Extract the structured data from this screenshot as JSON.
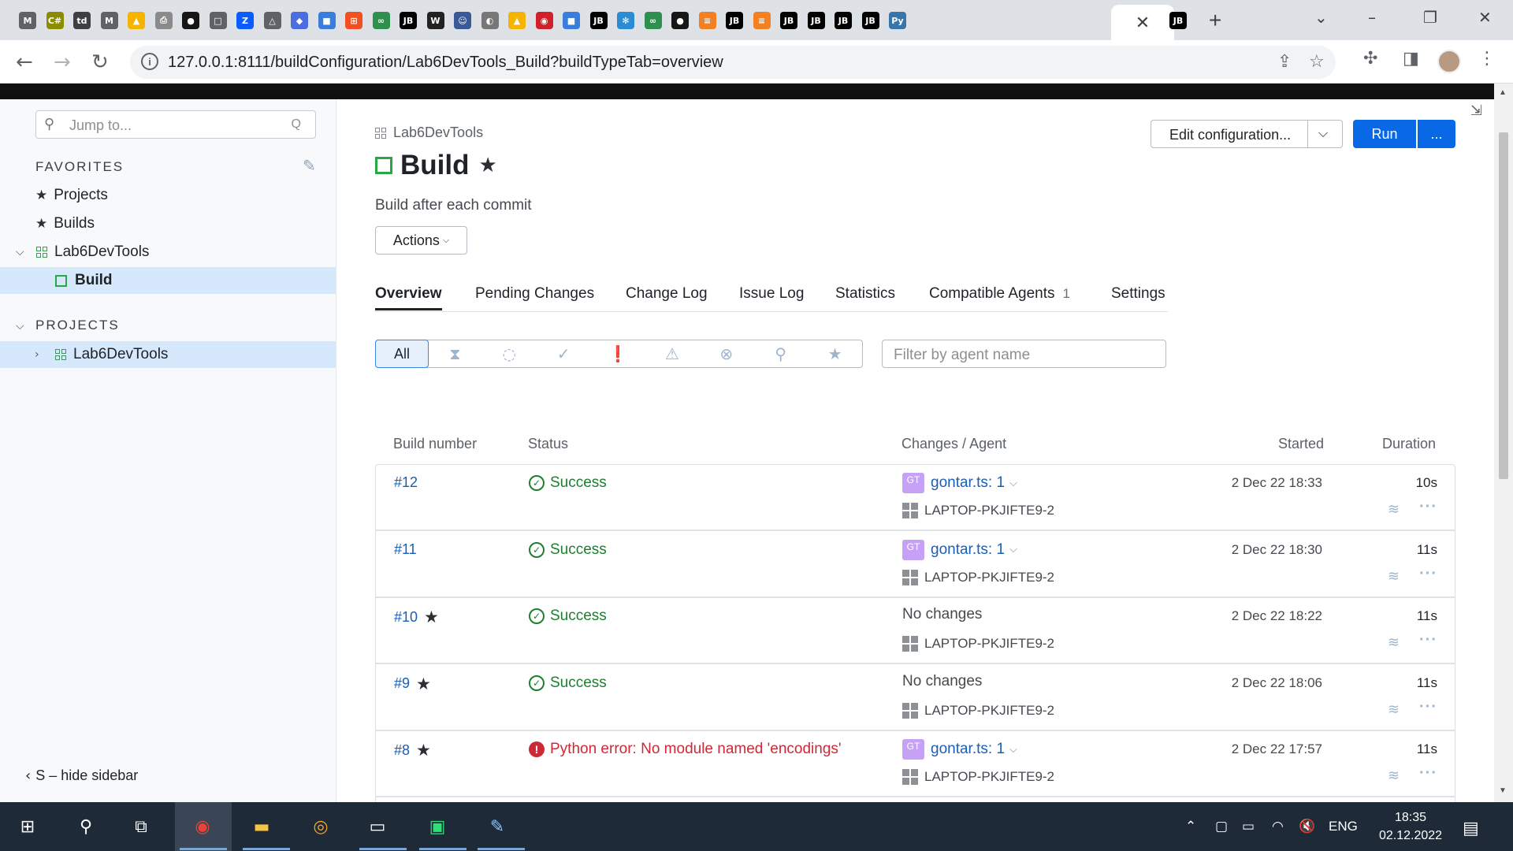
{
  "browser": {
    "tabs": [
      {
        "icon": "gmail-icon",
        "glyph": "M",
        "color": "#5f6368"
      },
      {
        "icon": "cpp-icon",
        "glyph": "C#",
        "color": "#8c8c00"
      },
      {
        "icon": "td-icon",
        "glyph": "td",
        "color": "#3c4043"
      },
      {
        "icon": "gmail-icon",
        "glyph": "M",
        "color": "#5f6368"
      },
      {
        "icon": "google-drive-icon",
        "glyph": "▲",
        "color": "#f4b400"
      },
      {
        "icon": "printer-icon",
        "glyph": "⎙",
        "color": "#8a8a8a"
      },
      {
        "icon": "github-icon",
        "glyph": "●",
        "color": "#161616"
      },
      {
        "icon": "blank-page-icon",
        "glyph": "□",
        "color": "#5f6368"
      },
      {
        "icon": "zoom-icon",
        "glyph": "Z",
        "color": "#0b5cff"
      },
      {
        "icon": "triangle-icon",
        "glyph": "△",
        "color": "#5f6368"
      },
      {
        "icon": "cube-icon",
        "glyph": "◆",
        "color": "#4a6ee0"
      },
      {
        "icon": "box-icon",
        "glyph": "■",
        "color": "#3b7ddd"
      },
      {
        "icon": "microsoft-icon",
        "glyph": "⊞",
        "color": "#f25022"
      },
      {
        "icon": "gitlab-icon",
        "glyph": "∞",
        "color": "#2f8f4f"
      },
      {
        "icon": "jetbrains-icon",
        "glyph": "JB",
        "color": "#000000"
      },
      {
        "icon": "wikipedia-icon",
        "glyph": "W",
        "color": "#222222"
      },
      {
        "icon": "robot-icon",
        "glyph": "☺",
        "color": "#3b5998"
      },
      {
        "icon": "compass-icon",
        "glyph": "◐",
        "color": "#777777"
      },
      {
        "icon": "google-drive-icon",
        "glyph": "▲",
        "color": "#f4b400"
      },
      {
        "icon": "dsp-icon",
        "glyph": "◉",
        "color": "#d0202a"
      },
      {
        "icon": "box-icon",
        "glyph": "■",
        "color": "#3b7ddd"
      },
      {
        "icon": "jetbrains-icon",
        "glyph": "JB",
        "color": "#000000"
      },
      {
        "icon": "gear-icon",
        "glyph": "✻",
        "color": "#2a8cd2"
      },
      {
        "icon": "gitlab-icon",
        "glyph": "∞",
        "color": "#2f8f4f"
      },
      {
        "icon": "github-icon",
        "glyph": "●",
        "color": "#161616"
      },
      {
        "icon": "stackoverflow-icon",
        "glyph": "≡",
        "color": "#f48024"
      },
      {
        "icon": "jetbrains-icon",
        "glyph": "JB",
        "color": "#000000"
      },
      {
        "icon": "stackoverflow-icon",
        "glyph": "≡",
        "color": "#f48024"
      },
      {
        "icon": "jetbrains-icon",
        "glyph": "JB",
        "color": "#000000"
      },
      {
        "icon": "jetbrains-icon",
        "glyph": "JB",
        "color": "#000000"
      },
      {
        "icon": "jetbrains-icon",
        "glyph": "JB",
        "color": "#000000"
      },
      {
        "icon": "jetbrains-icon",
        "glyph": "JB",
        "color": "#000000"
      },
      {
        "icon": "python-icon",
        "glyph": "Py",
        "color": "#3776ab"
      }
    ],
    "active_tab": {
      "close_glyph": "✕"
    },
    "after_tabs": [
      {
        "icon": "jetbrains-icon",
        "glyph": "JB",
        "color": "#000000"
      }
    ],
    "new_tab": "+",
    "url": "127.0.0.1:8111/buildConfiguration/Lab6DevTools_Build?buildTypeTab=overview"
  },
  "sidebar": {
    "search_placeholder": "Jump to...",
    "favorites_head": "FAVORITES",
    "fav_items": [
      "Projects",
      "Builds"
    ],
    "fav_project": "Lab6DevTools",
    "fav_build": "Build",
    "projects_head": "PROJECTS",
    "project": "Lab6DevTools",
    "hide_label": "S – hide sidebar"
  },
  "page": {
    "breadcrumb": "Lab6DevTools",
    "title": "Build",
    "description": "Build after each commit",
    "actions_label": "Actions",
    "edit_label": "Edit configuration...",
    "run_label": "Run",
    "run_more": "...",
    "tabs": [
      "Overview",
      "Pending Changes",
      "Change Log",
      "Issue Log",
      "Statistics",
      "Compatible Agents",
      "Settings"
    ],
    "agents_count": "1",
    "filter_all": "All",
    "agent_filter_placeholder": "Filter by agent name"
  },
  "table": {
    "headers": [
      "Build number",
      "Status",
      "Changes / Agent",
      "Started",
      "Duration"
    ],
    "rows": [
      {
        "number": "#12",
        "starred": false,
        "status": "Success",
        "ok": true,
        "committer": "gontar.ts: 1",
        "agent": "LAPTOP-PKJIFTE9-2",
        "started": "2 Dec 22 18:33",
        "duration": "10s"
      },
      {
        "number": "#11",
        "starred": false,
        "status": "Success",
        "ok": true,
        "committer": "gontar.ts: 1",
        "agent": "LAPTOP-PKJIFTE9-2",
        "started": "2 Dec 22 18:30",
        "duration": "11s"
      },
      {
        "number": "#10",
        "starred": true,
        "status": "Success",
        "ok": true,
        "committer": "No changes",
        "agent": "LAPTOP-PKJIFTE9-2",
        "started": "2 Dec 22 18:22",
        "duration": "11s"
      },
      {
        "number": "#9",
        "starred": true,
        "status": "Success",
        "ok": true,
        "committer": "No changes",
        "agent": "LAPTOP-PKJIFTE9-2",
        "started": "2 Dec 22 18:06",
        "duration": "11s"
      },
      {
        "number": "#8",
        "starred": true,
        "status": "Python error: No module named 'encodings'",
        "ok": false,
        "committer": "gontar.ts: 1",
        "agent": "LAPTOP-PKJIFTE9-2",
        "started": "2 Dec 22 17:57",
        "duration": "11s"
      }
    ]
  },
  "taskbar": {
    "language": "ENG",
    "time": "18:35",
    "date": "02.12.2022"
  },
  "colors": {
    "accent": "#0868e6",
    "success": "#1d7f2f",
    "error": "#cc2936",
    "link": "#1a5fb4"
  }
}
